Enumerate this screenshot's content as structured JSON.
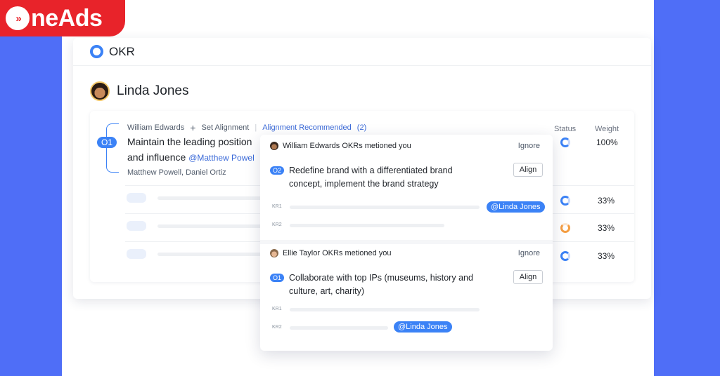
{
  "brand": {
    "logo_text": "neAds",
    "logo_mark": "»"
  },
  "app": {
    "title": "OKR"
  },
  "user": {
    "name": "Linda Jones"
  },
  "objective": {
    "badge": "O1",
    "supervisor": "William Edwards",
    "set_alignment": "Set Alignment",
    "alignment_recommended": "Alignment Recommended",
    "alignment_count": "(2)",
    "text": "Maintain the leading position and influence",
    "mention": "@Matthew Powel",
    "owners": "Matthew Powell, Daniel Ortiz"
  },
  "columns": {
    "status": "Status",
    "weight": "Weight"
  },
  "weights": [
    "100%",
    "33%",
    "33%",
    "33%"
  ],
  "notifications": [
    {
      "author": "William Edwards",
      "message": "OKRs metioned you",
      "ignore_label": "Ignore",
      "badge": "O2",
      "text": "Redefine brand with a differentiated brand concept, implement the brand strategy",
      "align_label": "Align",
      "kr1": "KR1",
      "kr2": "KR2",
      "mention": "@Linda Jones"
    },
    {
      "author": "Ellie Taylor",
      "message": "OKRs metioned you",
      "ignore_label": "Ignore",
      "badge": "O1",
      "text": "Collaborate with top IPs (museums, history and culture, art, charity)",
      "align_label": "Align",
      "kr1": "KR1",
      "kr2": "KR2",
      "mention": "@Linda Jones"
    }
  ],
  "colors": {
    "accent": "#3b82f6",
    "brand_red": "#e8232a",
    "background_blue": "#4f6ef7",
    "status_orange": "#f59e42"
  },
  "icons": [
    "okr-logo-icon",
    "avatar",
    "plus-icon",
    "status-ring-icon"
  ]
}
